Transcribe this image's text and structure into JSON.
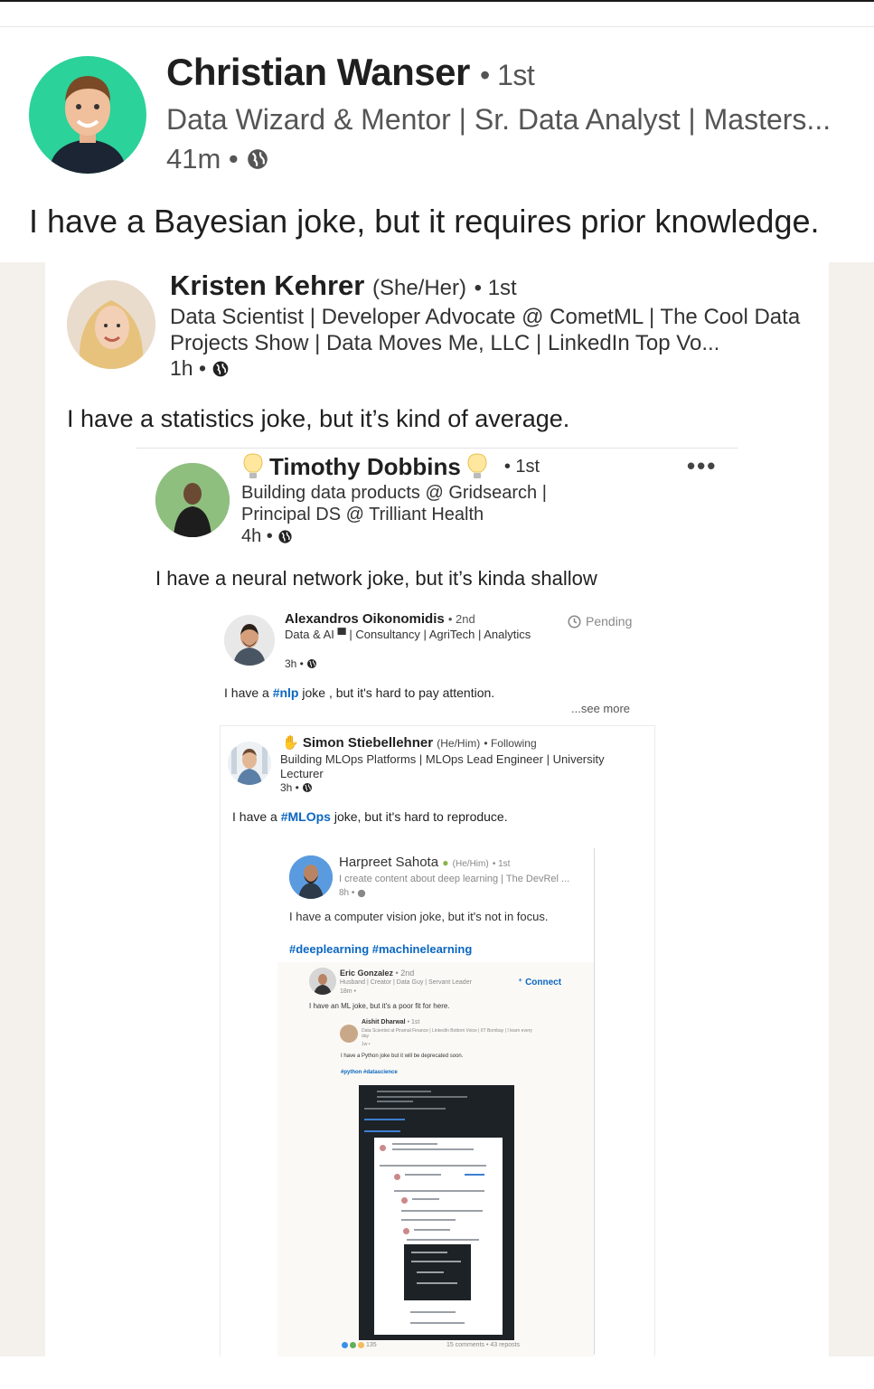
{
  "posts": [
    {
      "name": "Christian Wanser",
      "degree": "• 1st",
      "headline": "Data Wizard & Mentor | Sr. Data Analyst | Masters...",
      "time": "41m •",
      "text": "I have a Bayesian joke, but it requires prior knowledge."
    },
    {
      "name": "Kristen Kehrer",
      "pronouns": "(She/Her)",
      "degree": "• 1st",
      "headline": "Data Scientist | Developer Advocate @ CometML | The Cool Data Projects Show | Data Moves Me, LLC | LinkedIn Top Vo...",
      "time": "1h •",
      "text": "I have a statistics joke, but it’s kind of average."
    },
    {
      "name": "Timothy Dobbins",
      "degree": "• 1st",
      "more": "•••",
      "headline": "Building data products @ Gridsearch | Principal DS @ Trilliant Health",
      "time": "4h •",
      "text": "I have a neural network joke, but it’s kinda shallow"
    },
    {
      "name": "Alexandros Oikonomidis",
      "degree": "• 2nd",
      "pending": "Pending",
      "headline": "Data & AI ▀ | Consultancy | AgriTech | Analytics",
      "time": "3h •",
      "text_before": "I have a ",
      "hashtag": "#nlp",
      "text_after": " joke , but it's hard to pay attention.",
      "see_more": "...see more"
    },
    {
      "name": "Simon Stiebellehner",
      "pronouns": "(He/Him)",
      "degree": "• Following",
      "headline": "Building MLOps Platforms | MLOps Lead Engineer | University Lecturer",
      "time": "3h •",
      "text_before": "I have a ",
      "hashtag": "#MLOps",
      "text_after": " joke, but it's hard to reproduce."
    },
    {
      "name": "Harpreet Sahota",
      "pronouns": "(He/Him)",
      "degree": "• 1st",
      "headline": "I create content about deep learning | The DevRel ...",
      "time": "8h •",
      "text": "I have a computer vision joke, but it's not in focus.",
      "hashtags": "#deeplearning #machinelearning"
    },
    {
      "name": "Eric Gonzalez",
      "degree": "• 2nd",
      "headline": "Husband | Creator | Data Guy | Servant Leader",
      "time": "18m •",
      "connect": "Connect",
      "text": "I have an ML joke, but it's a poor fit for here."
    },
    {
      "name": "Aishit Dharwal",
      "degree": "• 1st",
      "headline": "Data Scientist at Piramal Finance | LinkedIn Bottom Voice | IIT Bombay | I learn every day",
      "time": "1w •",
      "text": "I have a Python joke but it will be deprecated soon.",
      "hashtags": "#python #datascience"
    }
  ],
  "footer": {
    "reactions": "135",
    "comments": "15 comments • 43 reposts"
  },
  "colors": {
    "link": "#0a66c2",
    "avatar_ring": "#2bd29a",
    "page_side": "#f4f1ec"
  },
  "icons": {
    "visibility": "globe-icon",
    "pending": "clock-icon",
    "connect": "add-person-icon",
    "lightbulb": "lightbulb-icon"
  }
}
